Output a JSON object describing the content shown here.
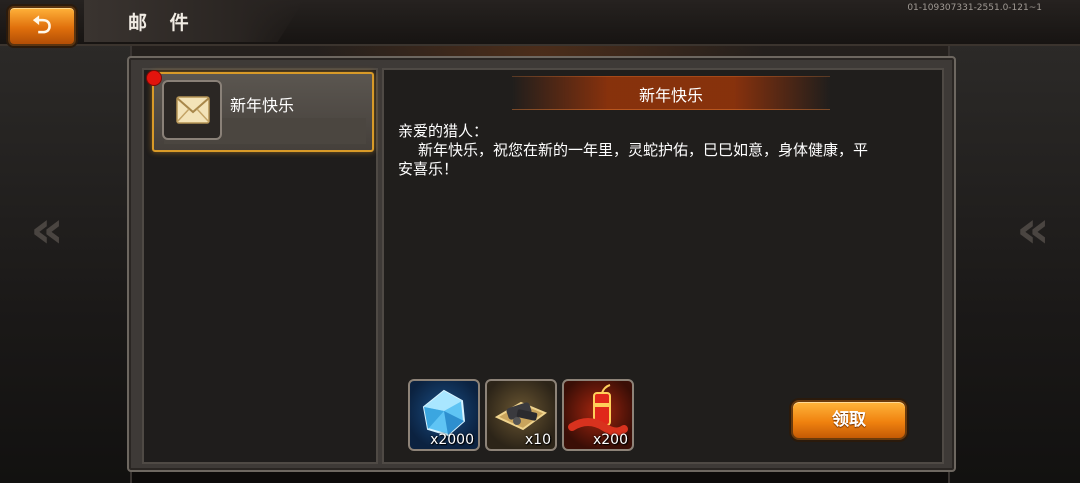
{
  "header": {
    "back_icon": "return-arrow-icon",
    "title": "邮 件",
    "build_id": "01-109307331-2551.0-121~1"
  },
  "mail_list": {
    "items": [
      {
        "label": "新年快乐",
        "icon": "envelope-icon",
        "unread": true,
        "selected": true
      }
    ]
  },
  "message": {
    "title": "新年快乐",
    "greeting": "亲爱的猎人：",
    "body_line1": "新年快乐，祝您在新的一年里，灵蛇护佑，巳巳如意，身体健康，平",
    "body_line2": "安喜乐！"
  },
  "rewards": [
    {
      "icon": "blue-diamond-icon",
      "count": "x2000"
    },
    {
      "icon": "equipment-bundle-icon",
      "count": "x10"
    },
    {
      "icon": "firecracker-icon",
      "count": "x200"
    }
  ],
  "claim_button": {
    "label": "领取"
  },
  "colors": {
    "accent_orange": "#f0820f",
    "selection_gold": "#d89a28",
    "unread_red": "#e3140d",
    "title_bar_red": "#8c320c"
  }
}
